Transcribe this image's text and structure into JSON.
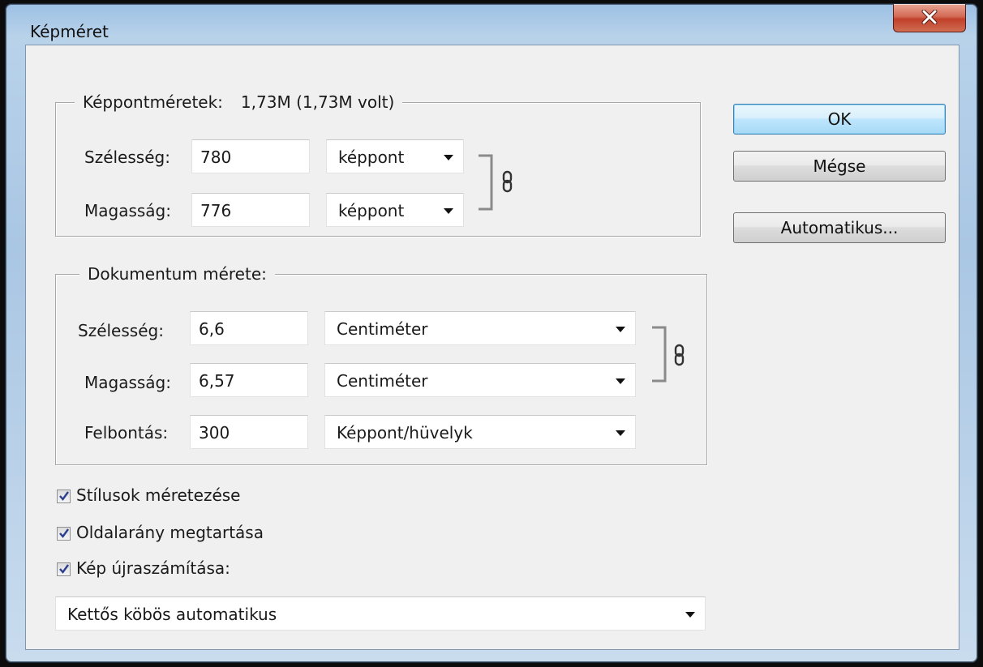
{
  "window": {
    "title": "Képméret"
  },
  "pixel_dimensions": {
    "legend": "Képpontméretek:",
    "size_value": "1,73M (1,73M volt)",
    "width": {
      "label": "Szélesség:",
      "value": "780",
      "unit": "képpont"
    },
    "height": {
      "label": "Magasság:",
      "value": "776",
      "unit": "képpont"
    }
  },
  "document_size": {
    "legend": "Dokumentum mérete:",
    "width": {
      "label": "Szélesség:",
      "value": "6,6",
      "unit": "Centiméter"
    },
    "height": {
      "label": "Magasság:",
      "value": "6,57",
      "unit": "Centiméter"
    },
    "resolution": {
      "label": "Felbontás:",
      "value": "300",
      "unit": "Képpont/hüvelyk"
    }
  },
  "options": {
    "scale_styles": {
      "label": "Stílusok méretezése",
      "checked": true
    },
    "constrain_proportions": {
      "label": "Oldalarány megtartása",
      "checked": true
    },
    "resample": {
      "label": "Kép újraszámítása:",
      "checked": true
    }
  },
  "resample_method": "Kettős köbös automatikus",
  "buttons": {
    "ok": "OK",
    "cancel": "Mégse",
    "auto": "Automatikus..."
  },
  "icons": {
    "close": "close-icon",
    "link": "chain-link-icon",
    "dropdown": "chevron-down-icon",
    "check": "checkmark-icon"
  }
}
